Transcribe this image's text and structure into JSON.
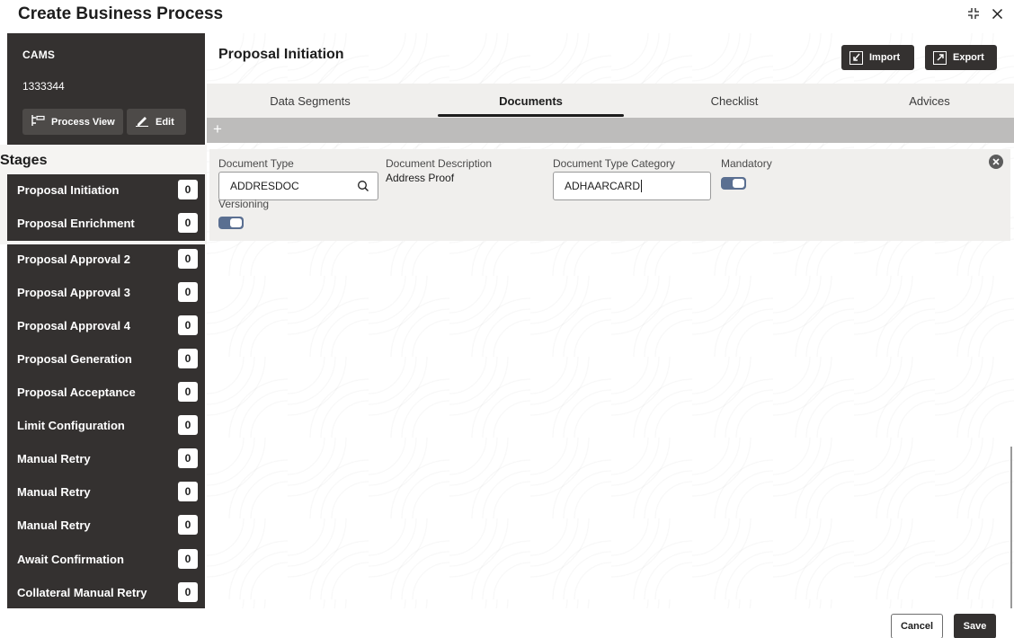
{
  "window": {
    "title": "Create Business Process",
    "icons": [
      "collapse-icon",
      "close-icon"
    ]
  },
  "sidebar": {
    "name": "CAMS",
    "id": "1333344",
    "process_view_label": "Process View",
    "edit_label": "Edit",
    "stages_title": "Stages",
    "stages": [
      {
        "label": "Proposal Initiation",
        "count": "0"
      },
      {
        "label": "Proposal Enrichment",
        "count": "0"
      },
      {
        "label": "Proposal Approval 2",
        "count": "0"
      },
      {
        "label": "Proposal Approval 3",
        "count": "0"
      },
      {
        "label": "Proposal Approval 4",
        "count": "0"
      },
      {
        "label": "Proposal Generation",
        "count": "0"
      },
      {
        "label": "Proposal Acceptance",
        "count": "0"
      },
      {
        "label": "Limit Configuration",
        "count": "0"
      },
      {
        "label": "Manual Retry",
        "count": "0"
      },
      {
        "label": "Manual Retry",
        "count": "0"
      },
      {
        "label": "Manual Retry",
        "count": "0"
      },
      {
        "label": "Await Confirmation",
        "count": "0"
      },
      {
        "label": "Collateral Manual Retry",
        "count": "0"
      }
    ]
  },
  "main": {
    "title": "Proposal Initiation",
    "import_label": "Import",
    "export_label": "Export",
    "tabs": [
      {
        "label": "Data Segments"
      },
      {
        "label": "Documents"
      },
      {
        "label": "Checklist"
      },
      {
        "label": "Advices"
      }
    ],
    "active_tab": "Documents",
    "add_symbol": "+",
    "document": {
      "type_label": "Document Type",
      "type_value": "ADDRESDOC",
      "description_label": "Document Description",
      "description_value": "Address Proof",
      "category_label": "Document Type Category",
      "category_value": "ADHAARCARD",
      "mandatory_label": "Mandatory",
      "mandatory_on": true,
      "versioning_label": "Versioning",
      "versioning_on": true
    }
  },
  "footer": {
    "cancel_label": "Cancel",
    "save_label": "Save"
  },
  "colors": {
    "sidebar_bg": "#343130",
    "toggle_on": "#5a6f91",
    "tab_bar_bg": "#f0efed",
    "add_bar_bg": "#bdbcbb"
  }
}
